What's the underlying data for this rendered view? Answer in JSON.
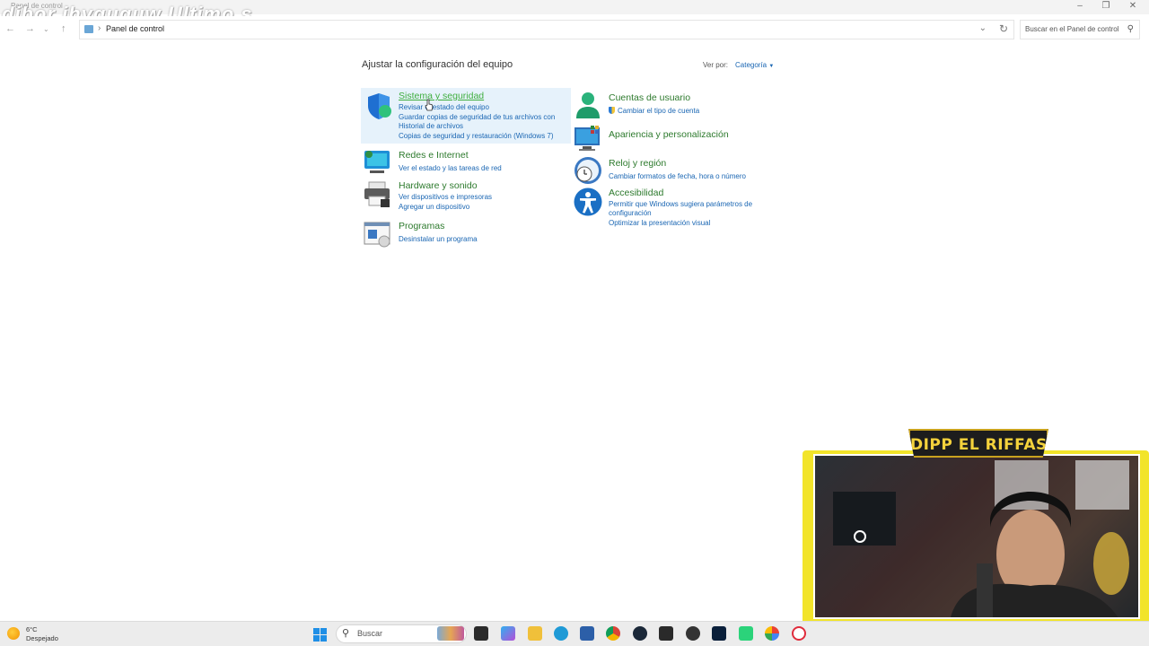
{
  "window": {
    "title": "Panel de control",
    "overlay_text": "dibor jhyquguw  Ultimo s"
  },
  "address": {
    "path": "Panel de control",
    "search_placeholder": "Buscar en el Panel de control"
  },
  "main": {
    "heading": "Ajustar la configuración del equipo",
    "view_by_label": "Ver por:",
    "view_by_value": "Categoría",
    "categories": [
      {
        "title": "Sistema y seguridad",
        "icon": "shield-icon",
        "links": [
          "Revisar el estado del equipo",
          "Guardar copias de seguridad de tus archivos con",
          "Historial de archivos",
          "Copias de seguridad y restauración (Windows 7)"
        ]
      },
      {
        "title": "Redes e Internet",
        "icon": "network-icon",
        "links": [
          "Ver el estado y las tareas de red"
        ]
      },
      {
        "title": "Hardware y sonido",
        "icon": "printer-icon",
        "links": [
          "Ver dispositivos e impresoras",
          "Agregar un dispositivo"
        ]
      },
      {
        "title": "Programas",
        "icon": "programs-icon",
        "links": [
          "Desinstalar un programa"
        ]
      },
      {
        "title": "Cuentas de usuario",
        "icon": "user-icon",
        "links": [
          "Cambiar el tipo de cuenta"
        ]
      },
      {
        "title": "Apariencia y personalización",
        "icon": "monitor-icon",
        "links": []
      },
      {
        "title": "Reloj y región",
        "icon": "clock-globe-icon",
        "links": [
          "Cambiar formatos de fecha, hora o número"
        ]
      },
      {
        "title": "Accesibilidad",
        "icon": "accessibility-icon",
        "links": [
          "Permitir que Windows sugiera parámetros de",
          "configuración",
          "Optimizar la presentación visual"
        ]
      }
    ]
  },
  "webcam": {
    "banner": "DIPP EL RIFFAS"
  },
  "taskbar": {
    "weather_temp": "6°C",
    "weather_desc": "Despejado",
    "search_text": "Buscar"
  },
  "colors": {
    "category_title": "#2d7a2d",
    "link": "#1a66b3",
    "highlight": "#e6f2fb",
    "webcam_frame": "#f2e42a"
  }
}
